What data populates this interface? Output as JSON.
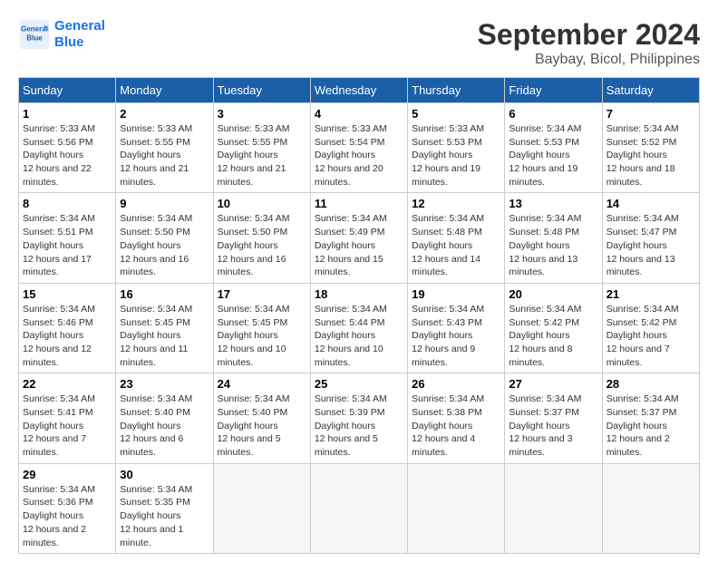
{
  "header": {
    "logo_line1": "General",
    "logo_line2": "Blue",
    "month_title": "September 2024",
    "location": "Baybay, Bicol, Philippines"
  },
  "weekdays": [
    "Sunday",
    "Monday",
    "Tuesday",
    "Wednesday",
    "Thursday",
    "Friday",
    "Saturday"
  ],
  "days": [
    {
      "num": "",
      "info": ""
    },
    {
      "num": "",
      "info": ""
    },
    {
      "num": "",
      "info": ""
    },
    {
      "num": "",
      "info": ""
    },
    {
      "num": "",
      "info": ""
    },
    {
      "num": "",
      "info": ""
    },
    {
      "num": "1",
      "sunrise": "5:33 AM",
      "sunset": "5:56 PM",
      "daylight": "12 hours and 22 minutes."
    },
    {
      "num": "2",
      "sunrise": "5:33 AM",
      "sunset": "5:55 PM",
      "daylight": "12 hours and 21 minutes."
    },
    {
      "num": "3",
      "sunrise": "5:33 AM",
      "sunset": "5:55 PM",
      "daylight": "12 hours and 21 minutes."
    },
    {
      "num": "4",
      "sunrise": "5:33 AM",
      "sunset": "5:54 PM",
      "daylight": "12 hours and 20 minutes."
    },
    {
      "num": "5",
      "sunrise": "5:33 AM",
      "sunset": "5:53 PM",
      "daylight": "12 hours and 19 minutes."
    },
    {
      "num": "6",
      "sunrise": "5:34 AM",
      "sunset": "5:53 PM",
      "daylight": "12 hours and 19 minutes."
    },
    {
      "num": "7",
      "sunrise": "5:34 AM",
      "sunset": "5:52 PM",
      "daylight": "12 hours and 18 minutes."
    },
    {
      "num": "8",
      "sunrise": "5:34 AM",
      "sunset": "5:51 PM",
      "daylight": "12 hours and 17 minutes."
    },
    {
      "num": "9",
      "sunrise": "5:34 AM",
      "sunset": "5:50 PM",
      "daylight": "12 hours and 16 minutes."
    },
    {
      "num": "10",
      "sunrise": "5:34 AM",
      "sunset": "5:50 PM",
      "daylight": "12 hours and 16 minutes."
    },
    {
      "num": "11",
      "sunrise": "5:34 AM",
      "sunset": "5:49 PM",
      "daylight": "12 hours and 15 minutes."
    },
    {
      "num": "12",
      "sunrise": "5:34 AM",
      "sunset": "5:48 PM",
      "daylight": "12 hours and 14 minutes."
    },
    {
      "num": "13",
      "sunrise": "5:34 AM",
      "sunset": "5:48 PM",
      "daylight": "12 hours and 13 minutes."
    },
    {
      "num": "14",
      "sunrise": "5:34 AM",
      "sunset": "5:47 PM",
      "daylight": "12 hours and 13 minutes."
    },
    {
      "num": "15",
      "sunrise": "5:34 AM",
      "sunset": "5:46 PM",
      "daylight": "12 hours and 12 minutes."
    },
    {
      "num": "16",
      "sunrise": "5:34 AM",
      "sunset": "5:45 PM",
      "daylight": "12 hours and 11 minutes."
    },
    {
      "num": "17",
      "sunrise": "5:34 AM",
      "sunset": "5:45 PM",
      "daylight": "12 hours and 10 minutes."
    },
    {
      "num": "18",
      "sunrise": "5:34 AM",
      "sunset": "5:44 PM",
      "daylight": "12 hours and 10 minutes."
    },
    {
      "num": "19",
      "sunrise": "5:34 AM",
      "sunset": "5:43 PM",
      "daylight": "12 hours and 9 minutes."
    },
    {
      "num": "20",
      "sunrise": "5:34 AM",
      "sunset": "5:42 PM",
      "daylight": "12 hours and 8 minutes."
    },
    {
      "num": "21",
      "sunrise": "5:34 AM",
      "sunset": "5:42 PM",
      "daylight": "12 hours and 7 minutes."
    },
    {
      "num": "22",
      "sunrise": "5:34 AM",
      "sunset": "5:41 PM",
      "daylight": "12 hours and 7 minutes."
    },
    {
      "num": "23",
      "sunrise": "5:34 AM",
      "sunset": "5:40 PM",
      "daylight": "12 hours and 6 minutes."
    },
    {
      "num": "24",
      "sunrise": "5:34 AM",
      "sunset": "5:40 PM",
      "daylight": "12 hours and 5 minutes."
    },
    {
      "num": "25",
      "sunrise": "5:34 AM",
      "sunset": "5:39 PM",
      "daylight": "12 hours and 5 minutes."
    },
    {
      "num": "26",
      "sunrise": "5:34 AM",
      "sunset": "5:38 PM",
      "daylight": "12 hours and 4 minutes."
    },
    {
      "num": "27",
      "sunrise": "5:34 AM",
      "sunset": "5:37 PM",
      "daylight": "12 hours and 3 minutes."
    },
    {
      "num": "28",
      "sunrise": "5:34 AM",
      "sunset": "5:37 PM",
      "daylight": "12 hours and 2 minutes."
    },
    {
      "num": "29",
      "sunrise": "5:34 AM",
      "sunset": "5:36 PM",
      "daylight": "12 hours and 2 minutes."
    },
    {
      "num": "30",
      "sunrise": "5:34 AM",
      "sunset": "5:35 PM",
      "daylight": "12 hours and 1 minute."
    },
    {
      "num": "",
      "info": ""
    },
    {
      "num": "",
      "info": ""
    },
    {
      "num": "",
      "info": ""
    },
    {
      "num": "",
      "info": ""
    },
    {
      "num": "",
      "info": ""
    }
  ]
}
